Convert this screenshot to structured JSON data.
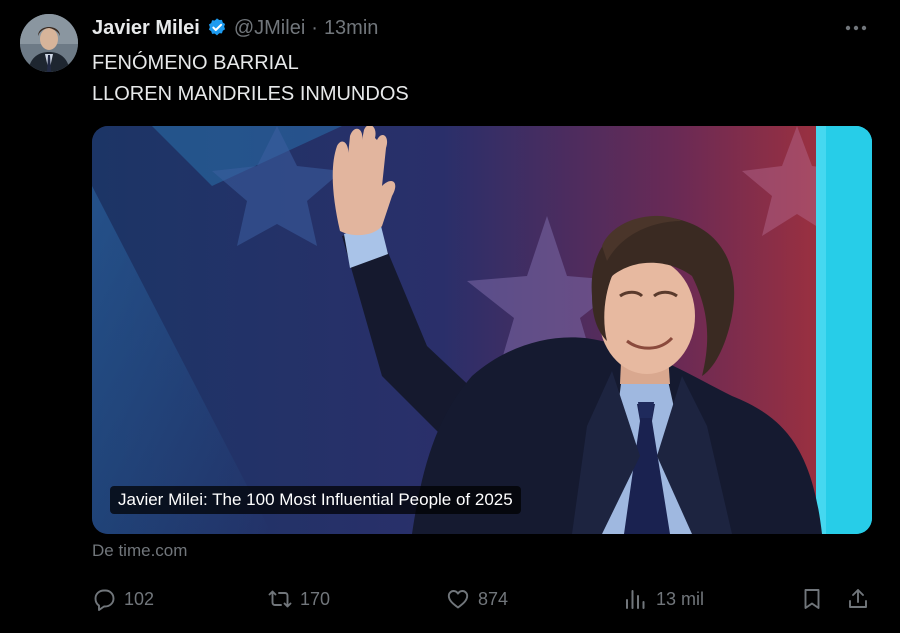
{
  "tweet": {
    "author_name": "Javier Milei",
    "author_handle": "@JMilei",
    "separator": "·",
    "time": "13min",
    "lines": [
      "FENÓMENO BARRIAL",
      "LLOREN MANDRILES INMUNDOS"
    ]
  },
  "media": {
    "caption": "Javier Milei: The 100 Most Influential People of 2025",
    "source": "De time.com"
  },
  "actions": {
    "replies": "102",
    "reposts": "170",
    "likes": "874",
    "views": "13 mil"
  },
  "icons": {
    "verified": "verified-badge-icon",
    "more": "more-horizontal-icon",
    "reply": "reply-icon",
    "repost": "repost-icon",
    "like": "heart-icon",
    "views": "views-icon",
    "bookmark": "bookmark-icon",
    "share": "share-icon"
  },
  "colors": {
    "background": "#000000",
    "text": "#e7e9ea",
    "muted": "#71767b",
    "verified": "#1d9bf0"
  }
}
